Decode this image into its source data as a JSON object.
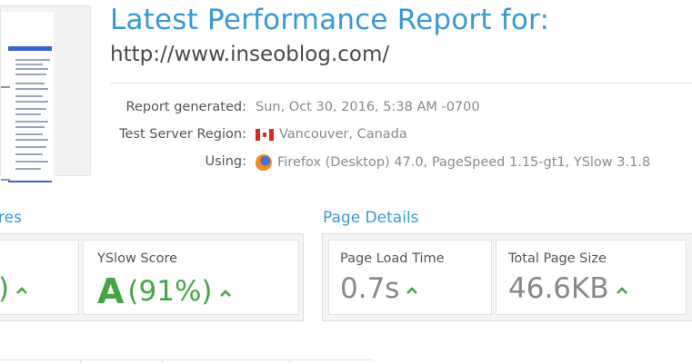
{
  "report": {
    "title": "Latest Performance Report for:",
    "url": "http://www.inseoblog.com/"
  },
  "info": {
    "generated_label": "Report generated:",
    "generated_value": "Sun, Oct 30, 2016, 5:38 AM -0700",
    "region_label": "Test Server Region:",
    "region_value": "Vancouver, Canada",
    "region_flag": "canada-flag-icon",
    "using_label": "Using:",
    "using_value": "Firefox (Desktop) 47.0, PageSpeed 1.15-gt1, YSlow 3.1.8",
    "using_icon": "firefox-icon"
  },
  "scores": {
    "section_title_partial": "res",
    "pagespeed_value_partial": ")",
    "yslow_label": "YSlow Score",
    "yslow_grade": "A",
    "yslow_percent": "(91%)"
  },
  "page_details": {
    "section_title": "Page Details",
    "load_time_label": "Page Load Time",
    "load_time_value": "0.7s",
    "size_label": "Total Page Size",
    "size_value": "46.6KB"
  },
  "colors": {
    "accent_blue": "#3a99d2",
    "grade_green": "#46a546",
    "value_gray": "#888888"
  }
}
